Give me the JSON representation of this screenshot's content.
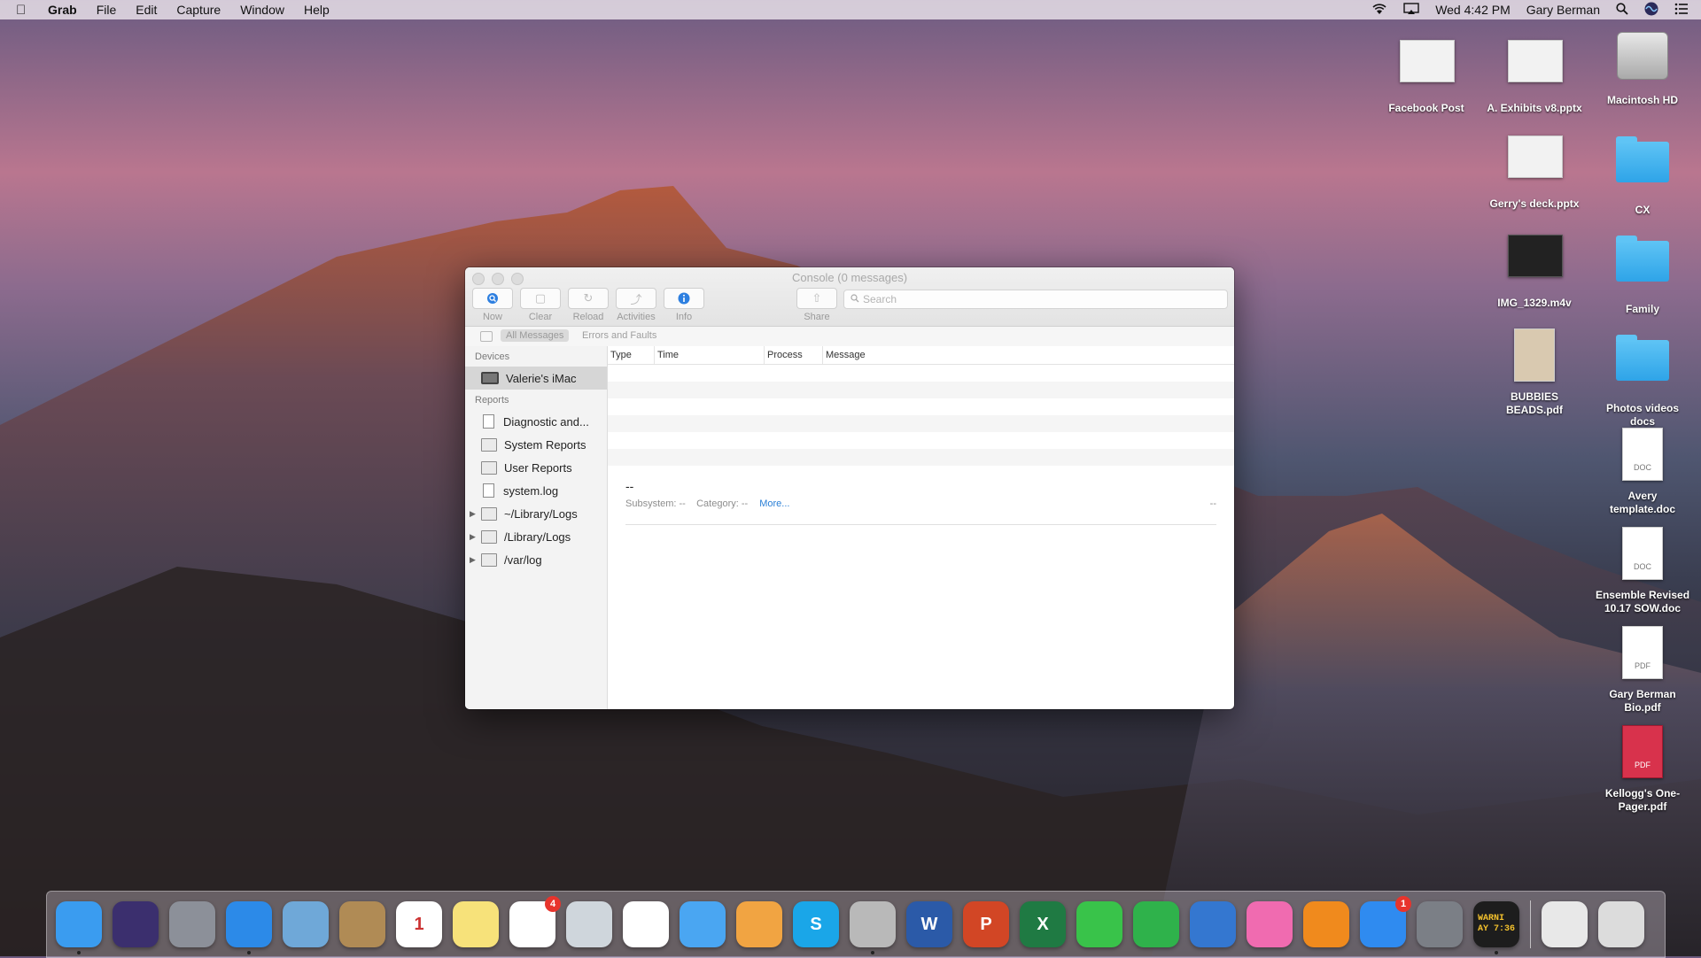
{
  "menubar": {
    "app": "Grab",
    "items": [
      "File",
      "Edit",
      "Capture",
      "Window",
      "Help"
    ],
    "clock": "Wed 4:42 PM",
    "user": "Gary Berman"
  },
  "desktop": {
    "icons": [
      {
        "label": "Facebook Post",
        "kind": "thumb"
      },
      {
        "label": "A. Exhibits v8.pptx",
        "kind": "thumb"
      },
      {
        "label": "Macintosh HD",
        "kind": "hd"
      },
      {
        "label": "Gerry's deck.pptx",
        "kind": "thumb"
      },
      {
        "label": "CX",
        "kind": "folder"
      },
      {
        "label": "IMG_1329.m4v",
        "kind": "video"
      },
      {
        "label": "Family",
        "kind": "folder"
      },
      {
        "label": "BUBBIES BEADS.pdf",
        "kind": "thumb"
      },
      {
        "label": "Photos videos docs",
        "kind": "folder"
      },
      {
        "label": "Avery template.doc",
        "kind": "doc",
        "tag": "DOC"
      },
      {
        "label": "Ensemble Revised 10.17 SOW.doc",
        "kind": "doc",
        "tag": "DOC"
      },
      {
        "label": "Gary Berman Bio.pdf",
        "kind": "doc",
        "tag": "PDF"
      },
      {
        "label": "Kellogg's One-Pager.pdf",
        "kind": "pdf-red",
        "tag": "PDF"
      }
    ]
  },
  "console": {
    "title": "Console (0 messages)",
    "toolbar": {
      "now": "Now",
      "clear": "Clear",
      "reload": "Reload",
      "activities": "Activities",
      "info": "Info",
      "share": "Share"
    },
    "search_placeholder": "Search",
    "filters": {
      "all": "All Messages",
      "errors": "Errors and Faults"
    },
    "sidebar": {
      "devices_header": "Devices",
      "device": "Valerie's iMac",
      "reports_header": "Reports",
      "reports": [
        {
          "label": "Diagnostic and...",
          "icon": "file"
        },
        {
          "label": "System Reports",
          "icon": "folder"
        },
        {
          "label": "User Reports",
          "icon": "folder"
        },
        {
          "label": "system.log",
          "icon": "file"
        },
        {
          "label": "~/Library/Logs",
          "icon": "folder",
          "expandable": true
        },
        {
          "label": "/Library/Logs",
          "icon": "folder",
          "expandable": true
        },
        {
          "label": "/var/log",
          "icon": "folder",
          "expandable": true
        }
      ]
    },
    "columns": {
      "type": "Type",
      "time": "Time",
      "process": "Process",
      "message": "Message"
    },
    "detail": {
      "header": "--",
      "subsystem": "Subsystem: --",
      "category": "Category: --",
      "more": "More...",
      "right": "--"
    }
  },
  "dock": {
    "apps": [
      {
        "name": "Finder",
        "icon": "finder-icon",
        "color": "#3a9cf0",
        "running": true
      },
      {
        "name": "Siri",
        "icon": "siri-icon",
        "color": "#3b2f6e"
      },
      {
        "name": "Launchpad",
        "icon": "launchpad-icon",
        "color": "#8c9099"
      },
      {
        "name": "Safari",
        "icon": "safari-icon",
        "color": "#2c8ae8",
        "running": true
      },
      {
        "name": "Mail",
        "icon": "mail-icon",
        "color": "#6fa8d8"
      },
      {
        "name": "Contacts",
        "icon": "contacts-icon",
        "color": "#b08b55"
      },
      {
        "name": "Calendar",
        "icon": "calendar-icon",
        "color": "#ffffff",
        "glyph": "1"
      },
      {
        "name": "Notes",
        "icon": "notes-icon",
        "color": "#f7e27a"
      },
      {
        "name": "Reminders",
        "icon": "reminders-icon",
        "color": "#ffffff",
        "badge": "4"
      },
      {
        "name": "Preview",
        "icon": "preview-icon",
        "color": "#cfd6dc"
      },
      {
        "name": "Photos",
        "icon": "photos-icon",
        "color": "#ffffff"
      },
      {
        "name": "Messages",
        "icon": "messages-icon",
        "color": "#4aa6f2"
      },
      {
        "name": "Pages",
        "icon": "pages-icon",
        "color": "#f1a442"
      },
      {
        "name": "Skype",
        "icon": "skype-icon",
        "color": "#1aa6e8",
        "glyph": "S"
      },
      {
        "name": "Grab",
        "icon": "grab-icon",
        "color": "#b9b9b9",
        "running": true
      },
      {
        "name": "Word",
        "icon": "word-icon",
        "color": "#2b5aa8",
        "glyph": "W"
      },
      {
        "name": "PowerPoint",
        "icon": "powerpoint-icon",
        "color": "#d24625",
        "glyph": "P"
      },
      {
        "name": "Excel",
        "icon": "excel-icon",
        "color": "#1f7a43",
        "glyph": "X"
      },
      {
        "name": "FaceTime",
        "icon": "facetime-icon",
        "color": "#39c34a"
      },
      {
        "name": "Numbers",
        "icon": "numbers-icon",
        "color": "#2fb24b"
      },
      {
        "name": "Keynote",
        "icon": "keynote-icon",
        "color": "#3477d0"
      },
      {
        "name": "iTunes",
        "icon": "itunes-icon",
        "color": "#f06bb0"
      },
      {
        "name": "iBooks",
        "icon": "ibooks-icon",
        "color": "#f08a1d"
      },
      {
        "name": "App Store",
        "icon": "appstore-icon",
        "color": "#2f8bf0",
        "badge": "1"
      },
      {
        "name": "System Preferences",
        "icon": "system-preferences-icon",
        "color": "#7b7f86"
      },
      {
        "name": "Console",
        "icon": "console-icon",
        "color": "#1d1d1d",
        "glyph": "WARNI\nAY 7:36",
        "running": true
      }
    ],
    "right": [
      {
        "name": "Downloads",
        "icon": "downloads-icon",
        "color": "#e8e8e8"
      },
      {
        "name": "Trash",
        "icon": "trash-icon",
        "color": "#dcdcdc"
      }
    ]
  }
}
